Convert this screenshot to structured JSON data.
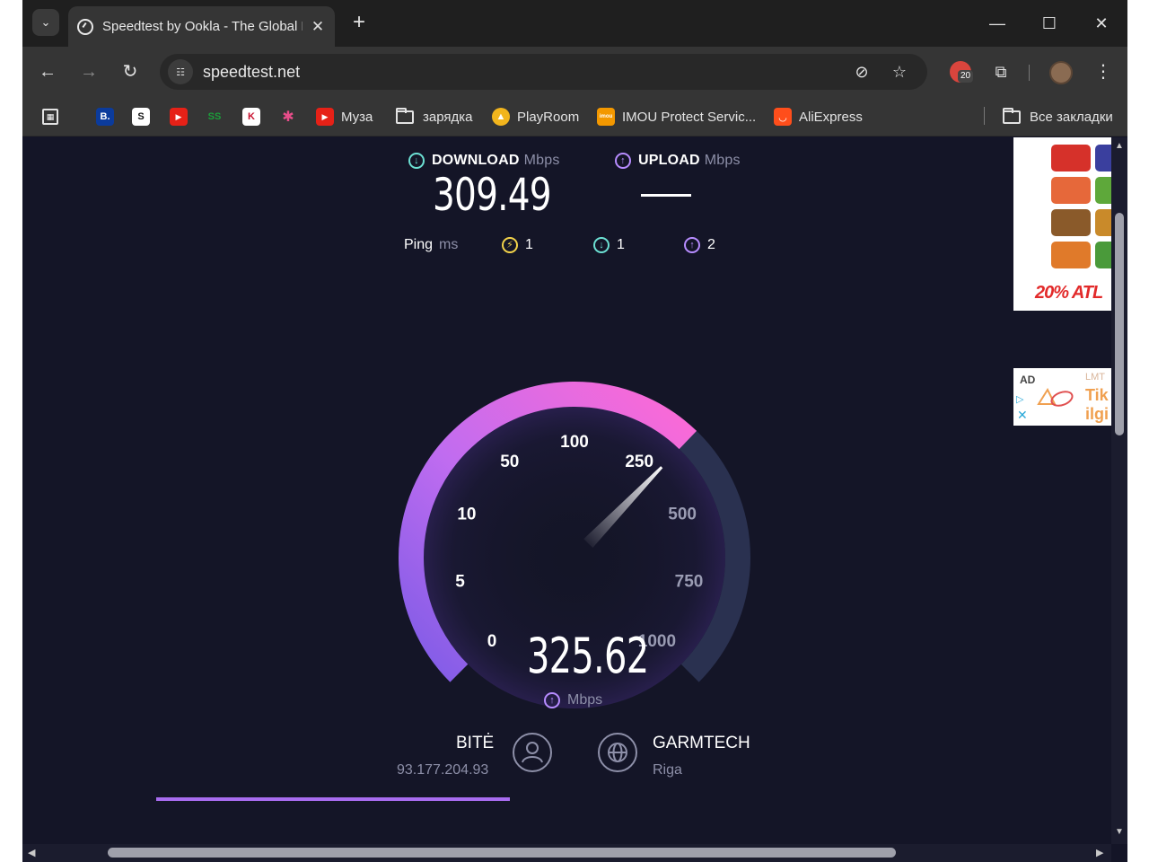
{
  "browser": {
    "tab_title": "Speedtest by Ookla - The Global Broadband Speed Test",
    "tab_close": "✕",
    "new_tab": "+",
    "url": "speedtest.net",
    "extension_badge": "20",
    "window_controls": {
      "minimize": "—",
      "maximize": "☐",
      "close": "✕"
    }
  },
  "bookmarks": [
    {
      "label": "",
      "icon": "apps-grid-icon"
    },
    {
      "label": "",
      "icon": "booking-icon",
      "glyph": "B.",
      "color": "#0b3b9c"
    },
    {
      "label": "",
      "icon": "s-app-icon",
      "glyph": "S",
      "color": "#111111"
    },
    {
      "label": "",
      "icon": "youtube-icon",
      "glyph": "▶",
      "color": "#e62117"
    },
    {
      "label": "",
      "icon": "ss-icon",
      "glyph": "SS",
      "color": "#1b6e2a"
    },
    {
      "label": "",
      "icon": "k-icon",
      "glyph": "K",
      "color": "#c8102e"
    },
    {
      "label": "",
      "icon": "puzzle-color-icon",
      "glyph": "✱",
      "color": "#3a8f3a"
    },
    {
      "label": "Муза",
      "icon": "youtube-icon",
      "glyph": "▶",
      "color": "#e62117"
    },
    {
      "label": "зарядка",
      "icon": "folder-icon"
    },
    {
      "label": "PlayRoom",
      "icon": "playroom-icon",
      "glyph": "▲",
      "color": "#f2b51d"
    },
    {
      "label": "IMOU Protect Servic...",
      "icon": "imou-icon",
      "glyph": "imou",
      "color": "#f39800"
    },
    {
      "label": "AliExpress",
      "icon": "aliexpress-icon",
      "glyph": "◡",
      "color": "#ff4e1b"
    },
    {
      "label": "Все закладки",
      "icon": "folder-icon"
    }
  ],
  "speedtest": {
    "download_label": "DOWNLOAD",
    "upload_label": "UPLOAD",
    "unit": "Mbps",
    "download_value": "309.49",
    "upload_value": "",
    "ping_label": "Ping",
    "ping_unit": "ms",
    "ping_idle": "1",
    "ping_download": "1",
    "ping_upload": "2",
    "current_speed": "325.62",
    "current_unit": "Mbps",
    "gauge_ticks": [
      "0",
      "5",
      "10",
      "50",
      "100",
      "250",
      "500",
      "750",
      "1000"
    ],
    "isp_name": "BITĖ",
    "isp_ip": "93.177.204.93",
    "server_name": "GARMTECH",
    "server_city": "Riga",
    "progress": 1.0
  },
  "ads": {
    "top_text": "20% ATL",
    "bottom_label": "AD",
    "bottom_lmt": "LMT",
    "bottom_tik": "Tik",
    "bottom_ilgi": "ilgi"
  },
  "colors": {
    "page_bg": "#141527",
    "gauge_track": "#2a3150",
    "gauge_fill_start": "#8b5cf6",
    "gauge_fill_end": "#ff6ad5",
    "download_accent": "#6ce0d3",
    "upload_accent": "#b78cff"
  }
}
